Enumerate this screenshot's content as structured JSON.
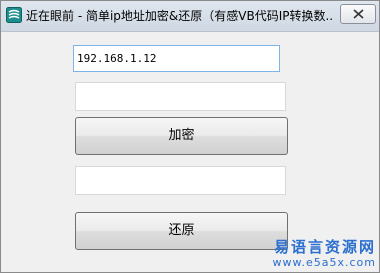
{
  "window": {
    "title": "近在眼前 - 简单ip地址加密&还原（有感VB代码IP转换数...",
    "icon": "app-logo-icon",
    "close_icon": "close-icon"
  },
  "form": {
    "ip_value": "192.168.1.12",
    "encrypted_value": "",
    "restored_value": "",
    "encrypt_label": "加密",
    "restore_label": "还原"
  },
  "watermark": {
    "cn": "易语言资源网",
    "url": "www.e5a5x.com"
  },
  "colors": {
    "focus_border": "#7eb4ea",
    "watermark": "#2b6fd0"
  }
}
